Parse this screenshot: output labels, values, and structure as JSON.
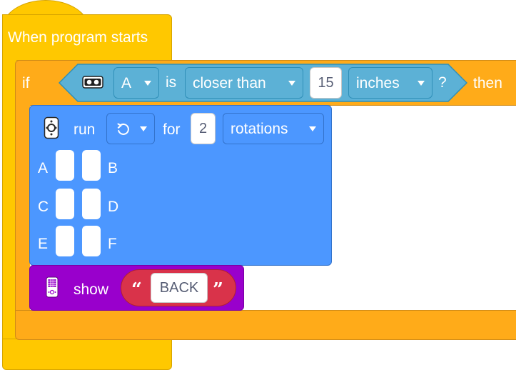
{
  "event_block": {
    "label": "When program starts"
  },
  "if_block": {
    "if_label": "if",
    "then_label": "then",
    "condition": {
      "sensor_icon": "distance-sensor-icon",
      "port": "A",
      "is_label": "is",
      "comparison": "closer than",
      "value": "15",
      "unit": "inches",
      "question": "?"
    }
  },
  "motor_block": {
    "icon": "motor-pair-icon",
    "run_label": "run",
    "direction_icon": "rotate-counterclockwise-icon",
    "for_label": "for",
    "amount": "2",
    "unit": "rotations",
    "ports": [
      {
        "left": "A",
        "right": "B"
      },
      {
        "left": "C",
        "right": "D"
      },
      {
        "left": "E",
        "right": "F"
      }
    ]
  },
  "display_block": {
    "icon": "light-matrix-icon",
    "show_label": "show",
    "open_quote": "“",
    "text": "BACK",
    "close_quote": "”"
  },
  "colors": {
    "events": "#ffc800",
    "control": "#ffab19",
    "sensors": "#5cb1d6",
    "motors": "#4c97ff",
    "display": "#9900cc",
    "text_input": "#d9334a"
  }
}
